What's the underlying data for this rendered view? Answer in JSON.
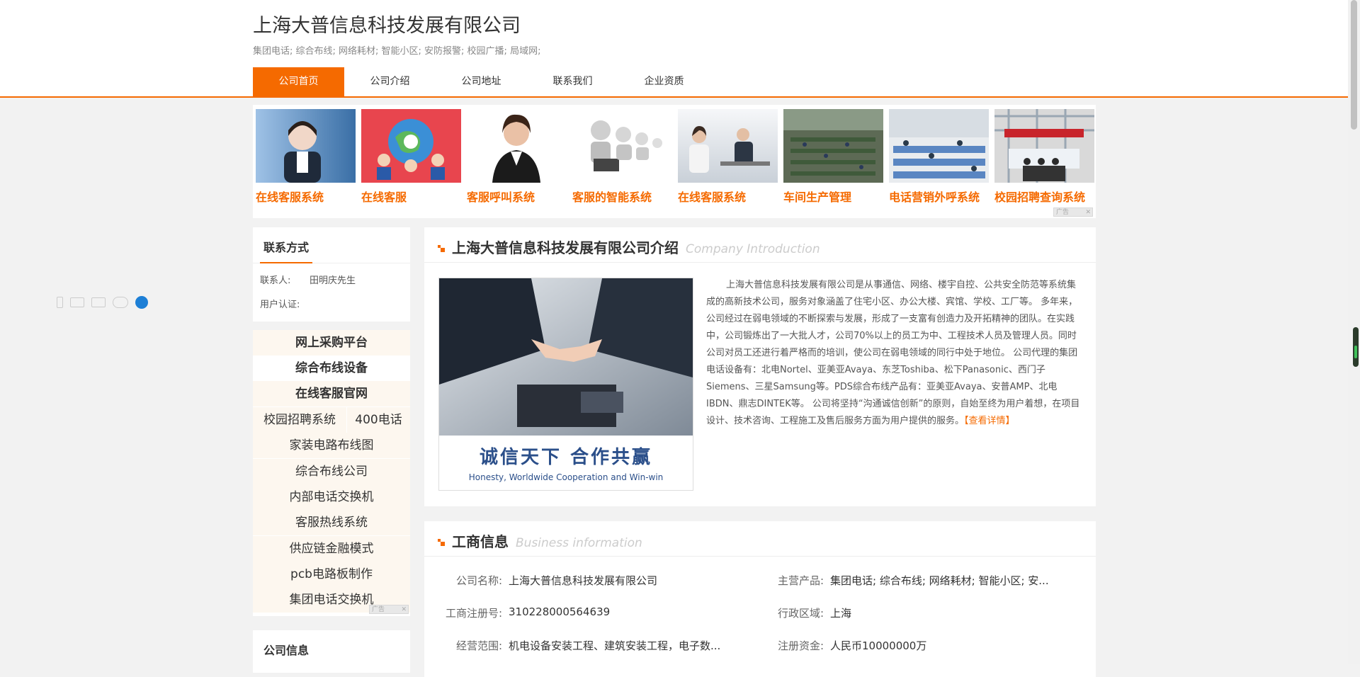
{
  "site": {
    "title": "上海大普信息科技发展有限公司",
    "subtitle": "集团电话; 综合布线; 网络耗材; 智能小区; 安防报警; 校园广播; 局域网;"
  },
  "nav": {
    "items": [
      "公司首页",
      "公司介绍",
      "公司地址",
      "联系我们",
      "企业资质"
    ],
    "active": "公司首页"
  },
  "ads": {
    "items": [
      {
        "label": "在线客服系统"
      },
      {
        "label": "在线客服"
      },
      {
        "label": "客服呼叫系统"
      },
      {
        "label": "客服的智能系统"
      },
      {
        "label": "在线客服系统"
      },
      {
        "label": "车间生产管理"
      },
      {
        "label": "电话营销外呼系统"
      },
      {
        "label": "校园招聘查询系统"
      }
    ],
    "flag": "广告"
  },
  "contact": {
    "title": "联系方式",
    "person_label": "联系人:",
    "person_value": "田明庆先生",
    "auth_label": "用户认证:"
  },
  "side_links": {
    "items": [
      "网上采购平台",
      "综合布线设备",
      "在线客服官网",
      "校园招聘系统",
      "400电话",
      "家装电路布线图",
      "综合布线公司",
      "内部电话交换机",
      "客服热线系统",
      "供应链金融模式",
      "pcb电路板制作",
      "集团电话交换机"
    ],
    "flag": "广告"
  },
  "company_info": {
    "title": "公司信息"
  },
  "intro": {
    "title": "上海大普信息科技发展有限公司介绍",
    "title_en": "Company Introduction",
    "slogan": "诚信天下    合作共赢",
    "slogan_en": "Honesty, Worldwide Cooperation and Win-win",
    "text": "上海大普信息科技发展有限公司是从事通信、网络、楼宇自控、公共安全防范等系统集成的高新技术公司，服务对象涵盖了住宅小区、办公大楼、宾馆、学校、工厂等。 多年来，公司经过在弱电领域的不断探索与发展，形成了一支富有创造力及开拓精神的团队。在实践中，公司锻炼出了一大批人才，公司70%以上的员工为中、工程技术人员及管理人员。同时公司对员工还进行着严格而的培训，使公司在弱电领域的同行中处于地位。 公司代理的集团电话设备有：北电Nortel、亚美亚Avaya、东芝Toshiba、松下Panasonic、西门子Siemens、三星Samsung等。PDS综合布线产品有：亚美亚Avaya、安普AMP、北电IBDN、鼎志DINTEK等。 公司将坚持“沟通诚信创新”的原则，自始至终为用户着想，在项目设计、技术咨询、工程施工及售后服务方面为用户提供的服务。",
    "more": "【查看详情】"
  },
  "business": {
    "title": "工商信息",
    "title_en": "Business information",
    "fields": [
      {
        "label": "公司名称:",
        "value": "上海大普信息科技发展有限公司"
      },
      {
        "label": "主营产品:",
        "value": "集团电话; 综合布线; 网络耗材; 智能小区; 安..."
      },
      {
        "label": "工商注册号:",
        "value": "310228000564639"
      },
      {
        "label": "行政区域:",
        "value": "上海"
      },
      {
        "label": "经营范围:",
        "value": "机电设备安装工程、建筑安装工程，电子数..."
      },
      {
        "label": "注册资金:",
        "value": "人民币10000000万"
      }
    ]
  },
  "colors": {
    "accent": "#f56a00",
    "background": "#f2f2f2"
  }
}
